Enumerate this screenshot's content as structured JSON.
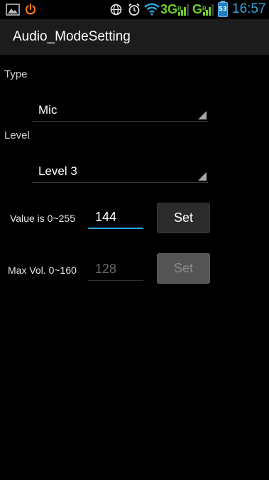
{
  "status_bar": {
    "icons": [
      "image-icon",
      "power-icon",
      "globe-icon",
      "alarm-icon",
      "wifi-icon",
      "signal-icon",
      "signal-icon",
      "battery-icon"
    ],
    "network_1": "3G",
    "network_1_sup": "R",
    "network_2": "G",
    "network_2_sup": "R",
    "battery_level": "53",
    "time": "16:57",
    "colors": {
      "network": "#6fcf2a",
      "time": "#2fa6e0",
      "battery": "#1f7fbf"
    }
  },
  "action_bar": {
    "title": "Audio_ModeSetting"
  },
  "form": {
    "type_label": "Type",
    "type_selected": "Mic",
    "level_label": "Level",
    "level_selected": "Level 3",
    "value_label": "Value is 0~255",
    "value_input": "144",
    "value_set_label": "Set",
    "max_vol_label": "Max Vol. 0~160",
    "max_vol_input": "128",
    "max_vol_set_label": "Set"
  },
  "colors": {
    "accent": "#2fa6e0",
    "background": "#000000",
    "action_bar": "#1c1c1c"
  }
}
